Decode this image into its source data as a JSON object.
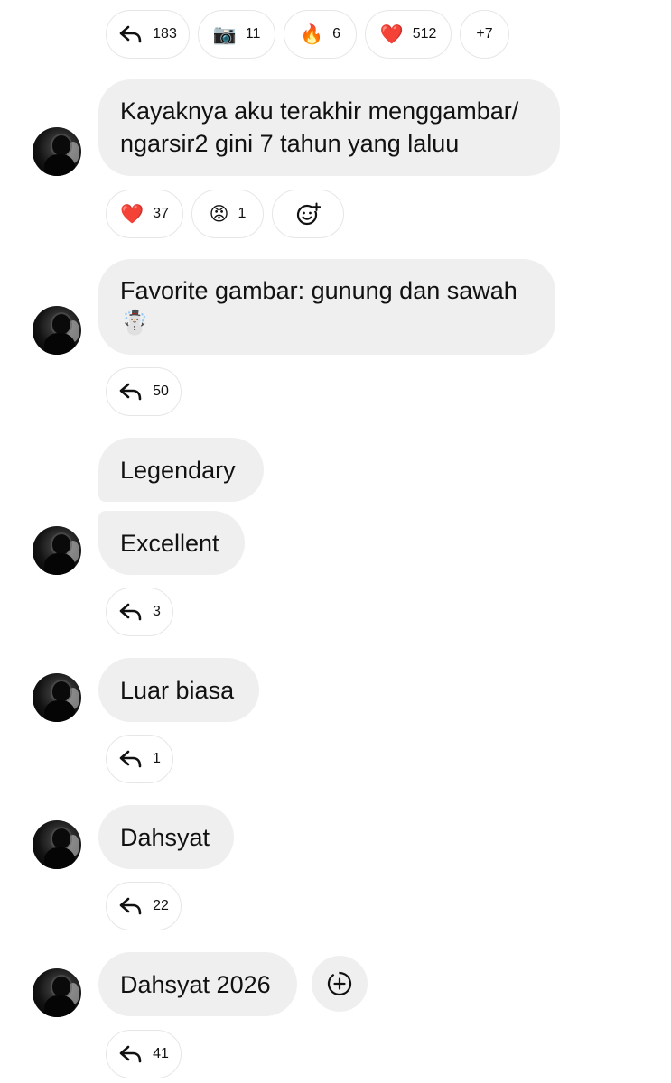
{
  "top_reactions": {
    "reply_count": "183",
    "camera_icon": "📷",
    "camera_count": "11",
    "fire_icon": "🔥",
    "fire_count": "6",
    "heart_icon": "❤️",
    "heart_count": "512",
    "more": "+7"
  },
  "messages": [
    {
      "lines": [
        "Kayaknya aku terakhir menggambar/",
        "ngarsir2 gini 7 tahun yang laluu"
      ],
      "reactions": {
        "heart_icon": "❤️",
        "heart_count": "37",
        "angry_icon": "😡",
        "angry_count": "1"
      }
    },
    {
      "lines": [
        "Favorite gambar: gunung dan sawah",
        "☃️"
      ],
      "reply_count": "50"
    },
    {
      "text": "Legendary"
    },
    {
      "text": "Excellent",
      "reply_count": "3"
    },
    {
      "text": "Luar biasa",
      "reply_count": "1"
    },
    {
      "text": "Dahsyat",
      "reply_count": "22"
    },
    {
      "text": "Dahsyat 2026",
      "reply_count": "41"
    }
  ],
  "icons": {
    "reply": "reply-arrow-icon",
    "add_reaction": "add-reaction-smiley-icon",
    "add": "add-circle-dashed-icon"
  },
  "colors": {
    "bubble": "#efefef",
    "pill_border": "#e6e6e6",
    "text": "#111111"
  }
}
